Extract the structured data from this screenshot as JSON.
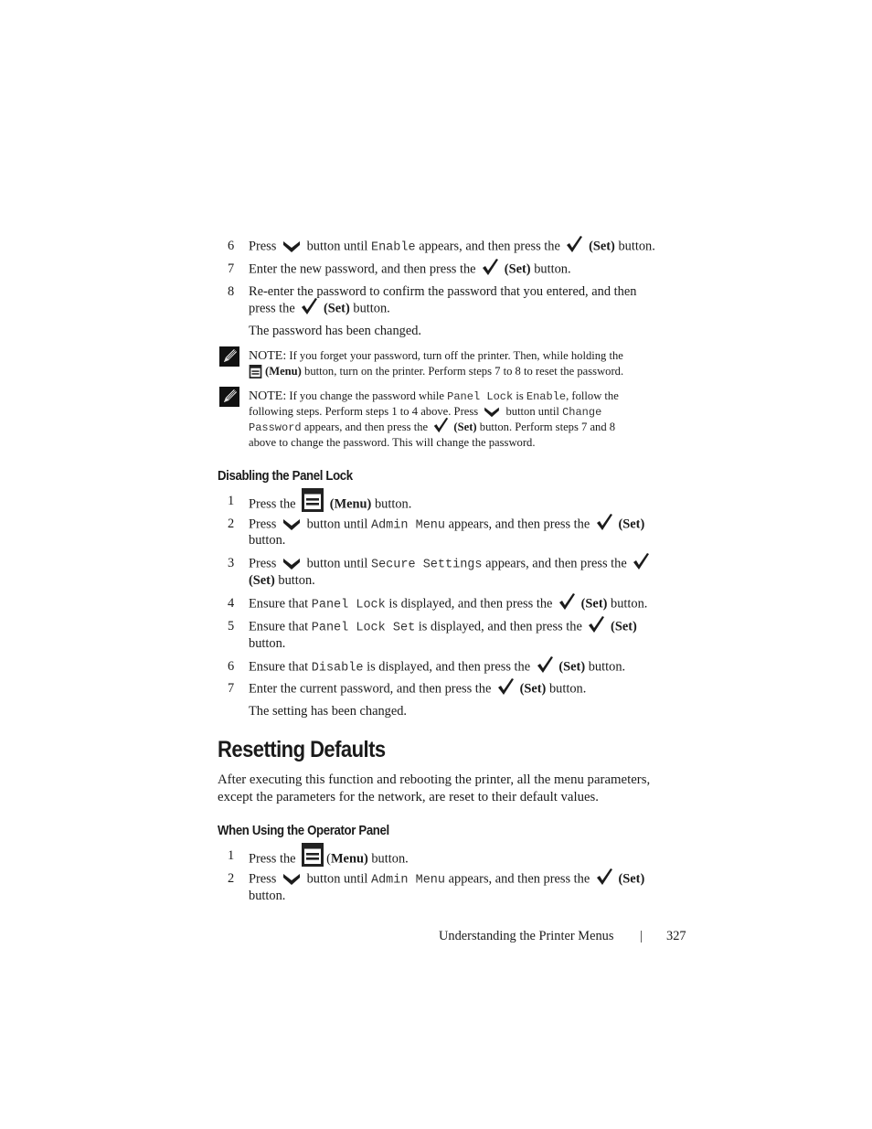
{
  "page": {
    "footer": {
      "section": "Understanding the Printer Menus",
      "separator": "|",
      "page_number": "327"
    }
  },
  "icons": {
    "down": "down-arrow-button-icon",
    "set": "checkmark-set-button-icon",
    "menu": "menu-button-icon",
    "note": "note-pencil-icon"
  },
  "top_steps": [
    {
      "n": "6",
      "a": "Press",
      "b": "button until",
      "code": "Enable",
      "c": "appears, and then press the",
      "set": "(Set)",
      "d": "button."
    },
    {
      "n": "7",
      "a": "Enter the new password, and then press the",
      "set": "(Set)",
      "d": "button."
    },
    {
      "n": "8",
      "line1": "Re-enter the password to confirm the password that you entered, and then",
      "a": "press the",
      "set": "(Set)",
      "d": "button."
    }
  ],
  "top_result": "The password has been changed.",
  "notes": [
    {
      "label": "NOTE:",
      "line1": "If you forget your password, turn off the printer. Then, while holding the",
      "menu": "(Menu)",
      "line2": "button, turn on the printer. Perform steps 7 to 8 to reset the password."
    },
    {
      "label": "NOTE:",
      "l1a": "If you change the password while",
      "code1": "Panel Lock",
      "l1b": "is",
      "code2": "Enable",
      "l1c": ", follow the",
      "l2a": "following steps. Perform steps 1 to 4 above. Press",
      "l2b": "button until",
      "code3a": "Change",
      "code3b": "Password",
      "l3a": "appears, and then press the",
      "set": "(Set)",
      "l3b": "button. Perform steps 7 and 8",
      "line4": "above to change the password. This will change the password."
    }
  ],
  "section_disable": {
    "heading": "Disabling the Panel Lock",
    "steps": [
      {
        "n": "1",
        "a": "Press the",
        "menu": "(Menu)",
        "d": "button."
      },
      {
        "n": "2",
        "a": "Press",
        "b": "button until",
        "code": "Admin Menu",
        "c": "appears, and then press the",
        "set": "(Set)",
        "d": "button."
      },
      {
        "n": "3",
        "a": "Press",
        "b": "button until",
        "code": "Secure Settings",
        "c": "appears, and then press the",
        "set": "(Set)",
        "d": "button."
      },
      {
        "n": "4",
        "a": "Ensure that",
        "code": "Panel Lock",
        "c": "is displayed, and then press the",
        "set": "(Set)",
        "d": "button."
      },
      {
        "n": "5",
        "a": "Ensure that",
        "code": "Panel Lock Set",
        "c": "is displayed, and then press the",
        "set": "(Set)",
        "d": "button."
      },
      {
        "n": "6",
        "a": "Ensure that",
        "code": "Disable",
        "c": "is displayed, and then press the",
        "set": "(Set)",
        "d": "button."
      },
      {
        "n": "7",
        "a": "Enter the current password, and then press the",
        "set": "(Set)",
        "d": "button."
      }
    ],
    "result": "The setting has been changed."
  },
  "section_reset": {
    "title": "Resetting Defaults",
    "intro_line1": "After executing this function and rebooting the printer, all the menu parameters,",
    "intro_line2": "except the parameters for the network, are reset to their default values.",
    "subheading": "When Using the Operator Panel",
    "steps": [
      {
        "n": "1",
        "a": "Press the",
        "menu_open": "(",
        "menu": "Menu)",
        "d": "button."
      },
      {
        "n": "2",
        "a": "Press",
        "b": "button until",
        "code": "Admin Menu",
        "c": "appears, and then press the",
        "set": "(Set)",
        "d": "button."
      }
    ]
  }
}
